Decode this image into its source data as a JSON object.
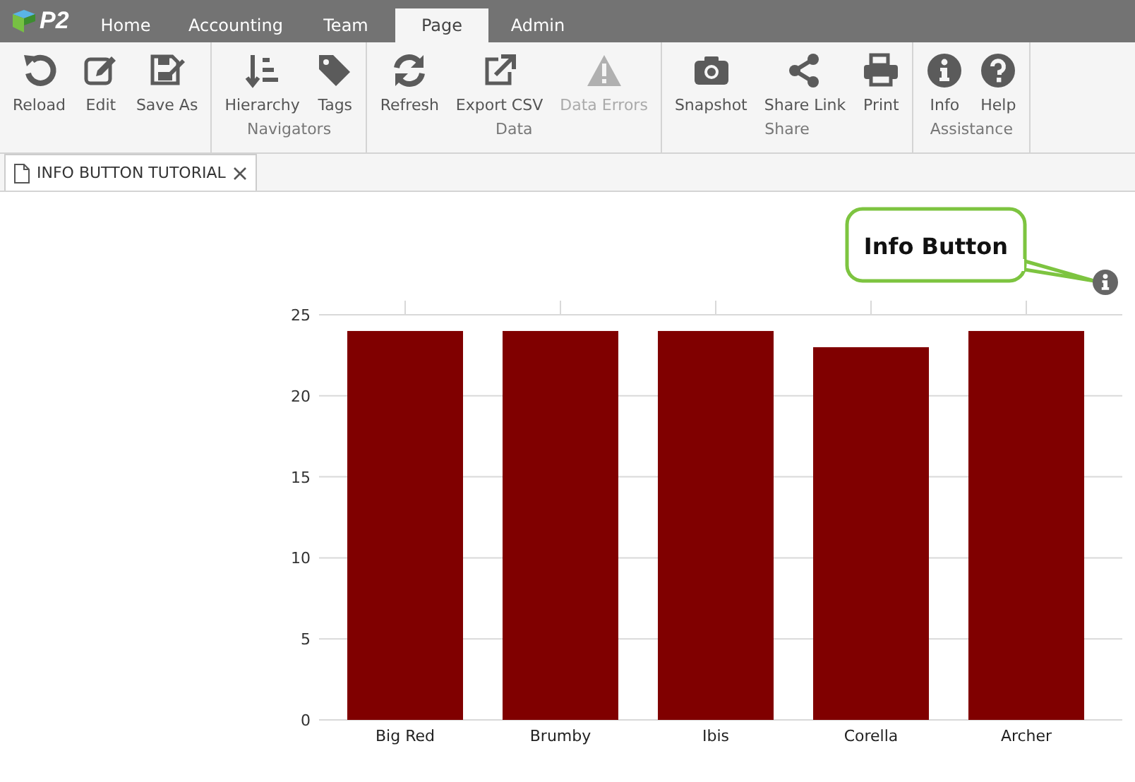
{
  "app_bar": {
    "logo": "P2",
    "tabs": [
      {
        "label": "Home",
        "selected": false
      },
      {
        "label": "Accounting",
        "selected": false
      },
      {
        "label": "Team",
        "selected": false
      },
      {
        "label": "Page",
        "selected": true
      },
      {
        "label": "Admin",
        "selected": false
      }
    ]
  },
  "ribbon": {
    "groups": [
      {
        "items": [
          {
            "label": "Reload",
            "disabled": false
          },
          {
            "label": "Edit",
            "disabled": false
          },
          {
            "label": "Save As",
            "disabled": false
          }
        ]
      },
      {
        "label": "Navigators",
        "items": [
          {
            "label": "Hierarchy",
            "disabled": false
          },
          {
            "label": "Tags",
            "disabled": false
          }
        ]
      },
      {
        "label": "Data",
        "items": [
          {
            "label": "Refresh",
            "disabled": false
          },
          {
            "label": "Export CSV",
            "disabled": false
          },
          {
            "label": "Data Errors",
            "disabled": true
          }
        ]
      },
      {
        "label": "Share",
        "items": [
          {
            "label": "Snapshot",
            "disabled": false
          },
          {
            "label": "Share Link",
            "disabled": false
          },
          {
            "label": "Print",
            "disabled": false
          }
        ]
      },
      {
        "label": "Assistance",
        "items": [
          {
            "label": "Info",
            "disabled": false
          },
          {
            "label": "Help",
            "disabled": false
          }
        ]
      }
    ]
  },
  "document_tabs": [
    {
      "title": "INFO BUTTON TUTORIAL",
      "selected": true
    }
  ],
  "callout": {
    "text": "Info Button"
  },
  "chart": {
    "chart_data": {
      "type": "bar",
      "categories": [
        "Big Red",
        "Brumby",
        "Ibis",
        "Corella",
        "Archer"
      ],
      "series": [
        {
          "color": "#800000",
          "values": [
            24,
            24,
            24,
            23,
            24
          ]
        }
      ],
      "grid": true,
      "ylim": [
        0,
        25
      ],
      "yticks": [
        0,
        5,
        10,
        15,
        20,
        25
      ]
    }
  }
}
